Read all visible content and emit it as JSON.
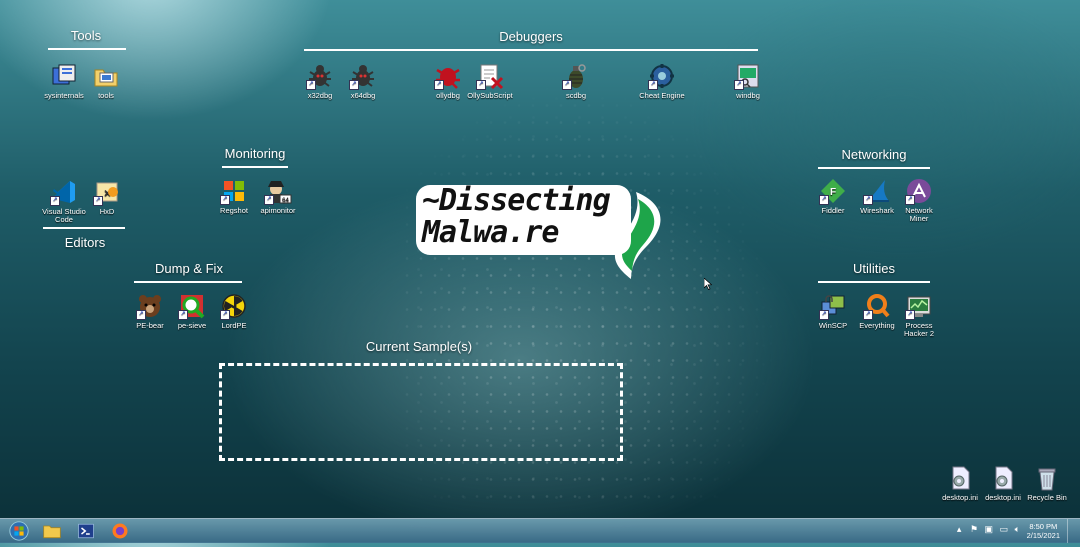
{
  "groups": {
    "tools": "Tools",
    "debuggers": "Debuggers",
    "monitoring": "Monitoring",
    "editors": "Editors",
    "dump_fix": "Dump & Fix",
    "networking": "Networking",
    "utilities": "Utilities",
    "current_samples": "Current Sample(s)"
  },
  "icons": {
    "sysinternals": "sysinternals",
    "tools": "tools",
    "x32dbg": "x32dbg",
    "x64dbg": "x64dbg",
    "ollydbg": "ollydbg",
    "ollysubscript": "OllySubScript",
    "scdbg": "scdbg",
    "cheat_engine": "Cheat Engine",
    "windbg": "windbg",
    "vscode": "Visual Studio Code",
    "hxd": "HxD",
    "regshot": "Regshot",
    "apimonitor": "apimonitor",
    "fiddler": "Fiddler",
    "wireshark": "Wireshark",
    "network_miner": "Network Miner",
    "pe_bear": "PE-bear",
    "pe_sieve": "pe-sieve",
    "lordpe": "LordPE",
    "winscp": "WinSCP",
    "everything": "Everything",
    "process_hacker": "Process Hacker 2",
    "desktop_ini_1": "desktop.ini",
    "desktop_ini_2": "desktop.ini",
    "recycle_bin": "Recycle Bin"
  },
  "logo": {
    "line1": "~Dissecting",
    "line2": "Malwa.re"
  },
  "taskbar": {
    "time": "8:50 PM",
    "date": "2/15/2021",
    "apimonitor_badge": "64"
  },
  "colors": {
    "accent_green": "#1ea54a",
    "taskbar": "#4f86a6"
  }
}
